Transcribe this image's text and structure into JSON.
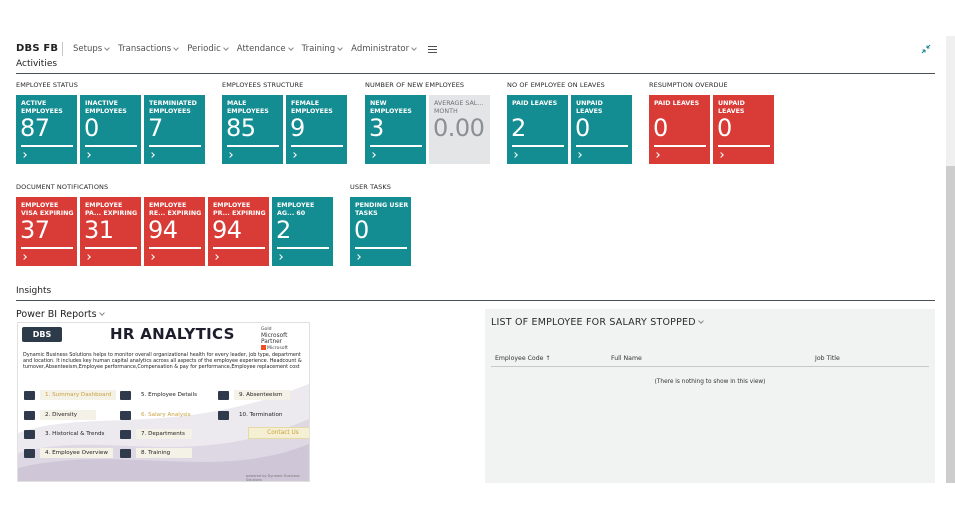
{
  "app": {
    "title": "DBS FB"
  },
  "nav": {
    "items": [
      {
        "label": "Setups"
      },
      {
        "label": "Transactions"
      },
      {
        "label": "Periodic"
      },
      {
        "label": "Attendance"
      },
      {
        "label": "Training"
      },
      {
        "label": "Administrator"
      }
    ],
    "menu_icon": "hamburger-icon",
    "collapse_icon": "collapse-arrows-icon"
  },
  "activities": {
    "heading": "Activities",
    "groups": {
      "employee_status": {
        "label": "EMPLOYEE STATUS",
        "tiles": [
          {
            "label": "ACTIVE EMPLOYEES",
            "value": "87",
            "color": "teal",
            "bar": 1.0
          },
          {
            "label": "INACTIVE EMPLOYEES",
            "value": "0",
            "color": "teal",
            "bar": 1.0
          },
          {
            "label": "TERMINIATED EMPLOYEES",
            "value": "7",
            "color": "teal",
            "bar": 1.0
          }
        ]
      },
      "employees_structure": {
        "label": "EMPLOYEES STRUCTURE",
        "tiles": [
          {
            "label": "MALE EMPLOYEES",
            "value": "85",
            "color": "teal",
            "bar": 1.0
          },
          {
            "label": "FEMALE EMPLOYEES",
            "value": "9",
            "color": "teal",
            "bar": 1.0
          }
        ]
      },
      "new_employees": {
        "label": "NUMBER OF NEW EMPLOYEES",
        "tiles": [
          {
            "label": "NEW EMPLOYEES",
            "value": "3",
            "color": "teal",
            "bar": 1.0
          },
          {
            "label": "AVERAGE SAL... MONTH",
            "value": "0.00",
            "color": "grey",
            "bar": 0
          }
        ]
      },
      "leaves": {
        "label": "NO OF EMPLOYEE ON LEAVES",
        "tiles": [
          {
            "label": "PAID LEAVES",
            "value": "2",
            "color": "teal",
            "bar": 1.0
          },
          {
            "label": "UNPAID LEAVES",
            "value": "0",
            "color": "teal",
            "bar": 1.0
          }
        ]
      },
      "resumption": {
        "label": "RESUMPTION OVERDUE",
        "tiles": [
          {
            "label": "PAID LEAVES",
            "value": "0",
            "color": "red",
            "bar": 1.0
          },
          {
            "label": "UNPAID LEAVES",
            "value": "0",
            "color": "red",
            "bar": 1.0
          }
        ]
      },
      "documents": {
        "label": "DOCUMENT NOTIFICATIONS",
        "tiles": [
          {
            "label": "EMPLOYEE VISA EXPIRING",
            "value": "37",
            "color": "red",
            "bar": 1.0
          },
          {
            "label": "EMPLOYEE PA... EXPIRING",
            "value": "31",
            "color": "red",
            "bar": 1.0
          },
          {
            "label": "EMPLOYEE RE... EXPIRING",
            "value": "94",
            "color": "red",
            "bar": 1.0
          },
          {
            "label": "EMPLOYEE PR... EXPIRING",
            "value": "94",
            "color": "red",
            "bar": 1.0
          },
          {
            "label": "EMPLOYEE AG... 60",
            "value": "2",
            "color": "teal",
            "bar": 1.0
          }
        ]
      },
      "user_tasks": {
        "label": "USER TASKS",
        "tiles": [
          {
            "label": "PENDING USER TASKS",
            "value": "0",
            "color": "teal",
            "bar": 1.0
          }
        ]
      }
    }
  },
  "insights": {
    "heading": "Insights",
    "powerbi": {
      "title": "Power BI Reports",
      "report": {
        "logo": "DBS",
        "heading": "HR ANALYTICS",
        "partner_gold": "Gold",
        "partner_name": "Microsoft Partner",
        "partner_ms": "Microsoft",
        "description": "Dynamic Business Solutions helps to monitor overall organizational health for every leader, job type, department and location. It includes key human capital analytics across all aspects of the employee experience. Headcount & turnover,Absenteeism,Employee performance,Compensation & pay for performance,Employee replacement cost",
        "buttons": [
          {
            "label": "1. Summary Dashboard",
            "active": true
          },
          {
            "label": "2. Diversity",
            "active": false
          },
          {
            "label": "3. Historical & Trends",
            "active": false
          },
          {
            "label": "4. Employee Overview",
            "active": false
          },
          {
            "label": "5. Employee Details",
            "active": false
          },
          {
            "label": "6. Salary Analysis",
            "active": true
          },
          {
            "label": "7. Departments",
            "active": false
          },
          {
            "label": "8. Training",
            "active": false
          },
          {
            "label": "9. Absenteeism",
            "active": false
          },
          {
            "label": "10. Termination",
            "active": false
          }
        ],
        "contact": "Contact Us",
        "powered": "powered by Dynamic Business Solutions"
      }
    },
    "salary_list": {
      "title": "LIST OF EMPLOYEE FOR SALARY STOPPED",
      "columns": [
        "Employee Code ↑",
        "Full Name",
        "Job Title"
      ],
      "empty_text": "(There is nothing to show in this view)"
    }
  },
  "colors": {
    "teal": "#148d92",
    "red": "#d93c37",
    "grey": "#e3e5e6"
  }
}
